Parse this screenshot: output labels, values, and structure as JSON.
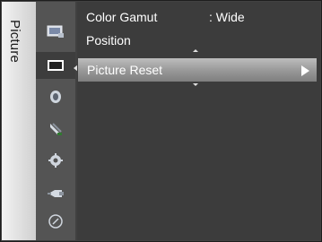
{
  "side_tab": {
    "label": "Picture"
  },
  "icons": [
    {
      "name": "picture-input-icon",
      "selected": false
    },
    {
      "name": "picture-tv-icon",
      "selected": true
    },
    {
      "name": "sound-icon",
      "selected": false
    },
    {
      "name": "channel-satellite-icon",
      "selected": false
    },
    {
      "name": "setup-gear-icon",
      "selected": false
    },
    {
      "name": "input-plug-icon",
      "selected": false
    },
    {
      "name": "support-icon",
      "selected": false
    }
  ],
  "menu": {
    "color_gamut_label": "Color Gamut",
    "color_gamut_value": ": Wide",
    "position_label": "Position",
    "picture_reset_label": "Picture Reset"
  }
}
